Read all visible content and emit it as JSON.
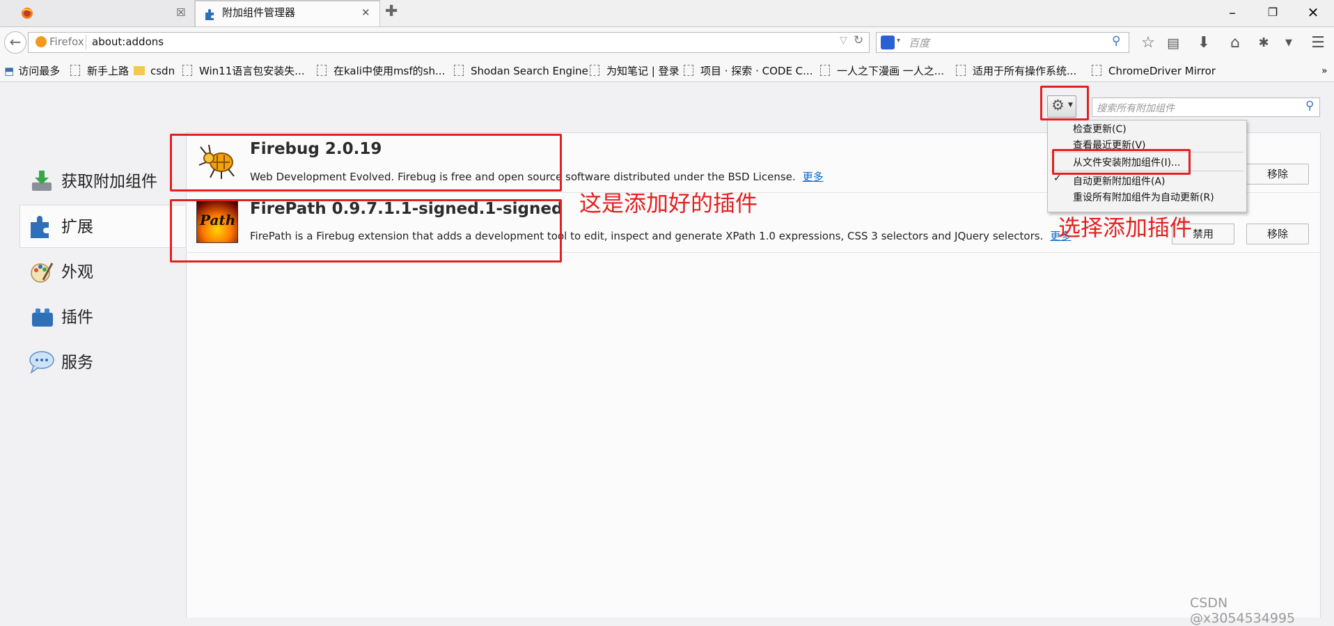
{
  "tabs": [
    {
      "title": ""
    },
    {
      "title": "附加组件管理器"
    }
  ],
  "nav": {
    "identity_label": "Firefox",
    "url": "about:addons",
    "search_placeholder": "百度"
  },
  "bookmarks": [
    "访问最多",
    "新手上路",
    "csdn",
    "Win11语言包安装失...",
    "在kali中使用msf的sh...",
    "Shodan Search Engine",
    "为知笔记 | 登录",
    "项目 · 探索 · CODE C...",
    "一人之下漫画 一人之...",
    "适用于所有操作系统...",
    "ChromeDriver Mirror"
  ],
  "categories": [
    {
      "label": "获取附加组件",
      "icon": "download-icon"
    },
    {
      "label": "扩展",
      "icon": "puzzle-icon"
    },
    {
      "label": "外观",
      "icon": "paintbrush-icon"
    },
    {
      "label": "插件",
      "icon": "lego-icon"
    },
    {
      "label": "服务",
      "icon": "chat-bubble-icon"
    }
  ],
  "addon_search_placeholder": "搜索所有附加组件",
  "addons": [
    {
      "name": "Firebug  2.0.19",
      "description": "Web Development Evolved. Firebug is free and open source software distributed under the BSD License.",
      "more": "更多",
      "remove_label": "移除"
    },
    {
      "name": "FirePath  0.9.7.1.1-signed.1-signed",
      "description": "FirePath is a Firebug extension that adds a development tool to edit, inspect and generate XPath 1.0 expressions, CSS 3 selectors and JQuery selectors.",
      "more": "更多",
      "disable_label": "禁用",
      "remove_label": "移除",
      "icon_text": "Path"
    }
  ],
  "tools_menu": [
    {
      "label": "检查更新(C)"
    },
    {
      "label": "查看最近更新(V)"
    },
    {
      "label": "从文件安装附加组件(I)..."
    },
    {
      "label": "自动更新附加组件(A)",
      "checked": true
    },
    {
      "label": "重设所有附加组件为自动更新(R)"
    }
  ],
  "annotations": {
    "installed": "这是添加好的插件",
    "choose_add": "选择添加插件"
  },
  "watermark": "CSDN @x3054534995",
  "colors": {
    "annotation_red": "#e3201f",
    "link_blue": "#0b66c6"
  }
}
